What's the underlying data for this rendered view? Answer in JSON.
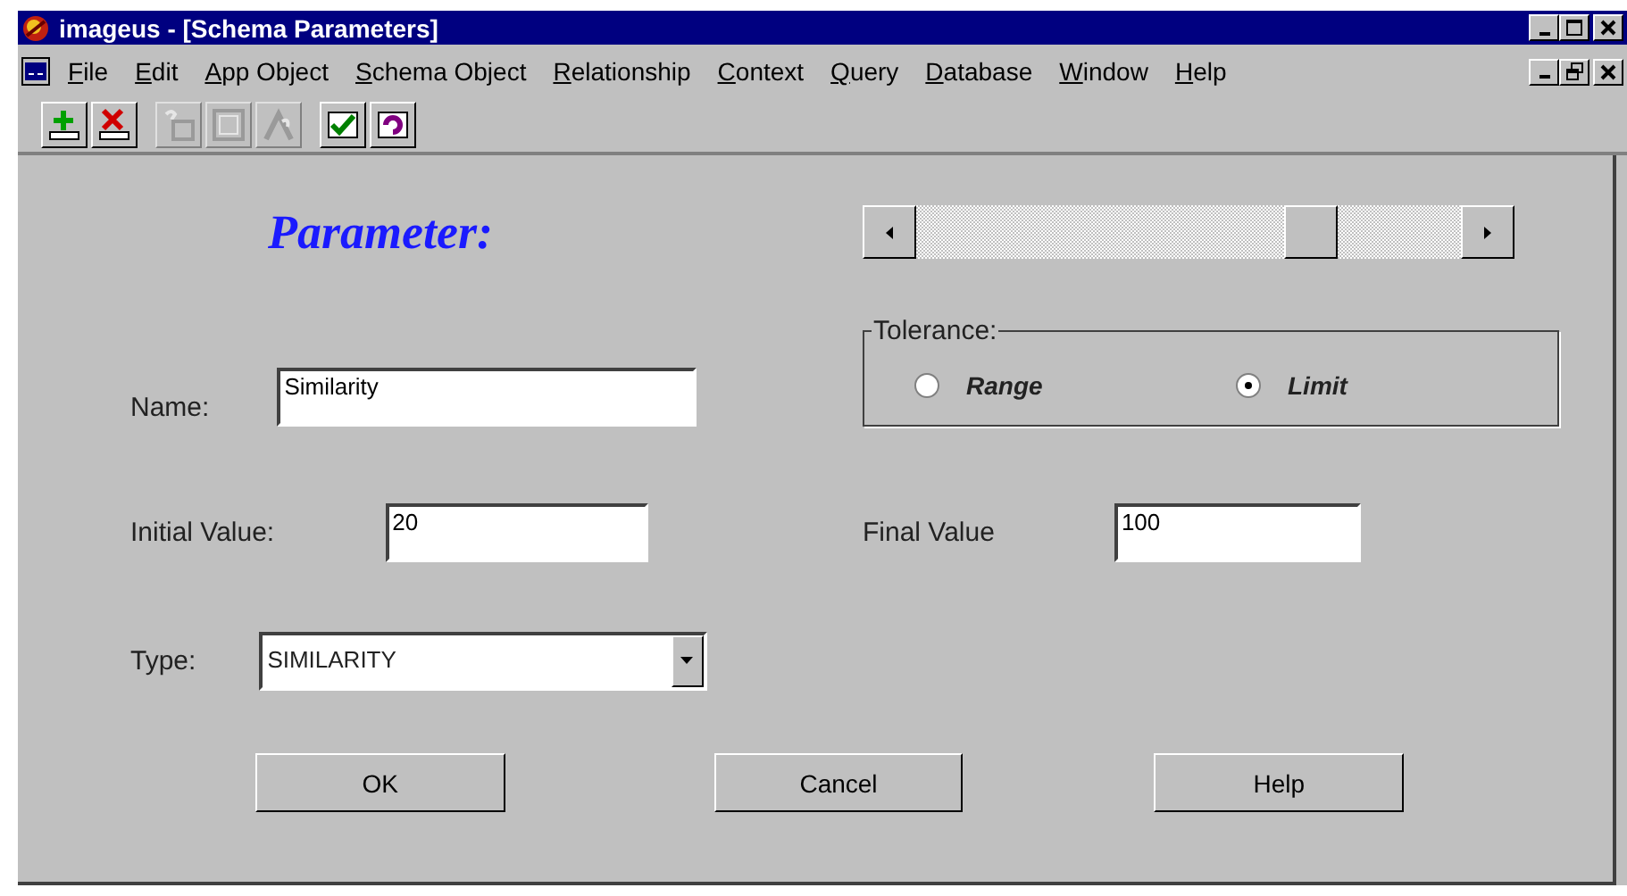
{
  "window": {
    "title": "imageus - [Schema Parameters]"
  },
  "menu": [
    "File",
    "Edit",
    "App Object",
    "Schema Object",
    "Relationship",
    "Context",
    "Query",
    "Database",
    "Window",
    "Help"
  ],
  "toolbar": [
    [
      {
        "kind": "add",
        "disabled": false
      },
      {
        "kind": "delete",
        "disabled": false
      }
    ],
    [
      {
        "kind": "object",
        "disabled": true
      },
      {
        "kind": "query",
        "disabled": true
      },
      {
        "kind": "relation",
        "disabled": true
      }
    ],
    [
      {
        "kind": "check",
        "disabled": false
      },
      {
        "kind": "cycle",
        "disabled": false
      }
    ]
  ],
  "dialog": {
    "heading": "Parameter:",
    "name": {
      "label": "Name:",
      "value": "Similarity"
    },
    "tolerance": {
      "label": "Tolerance:",
      "options": [
        {
          "label": "Range",
          "selected": false
        },
        {
          "label": "Limit",
          "selected": true
        }
      ]
    },
    "initial_value": {
      "label": "Initial Value:",
      "value": "20"
    },
    "final_value": {
      "label": "Final Value",
      "value": "100"
    },
    "type": {
      "label": "Type:",
      "value": "SIMILARITY"
    },
    "buttons": [
      "OK",
      "Cancel",
      "Help"
    ]
  }
}
